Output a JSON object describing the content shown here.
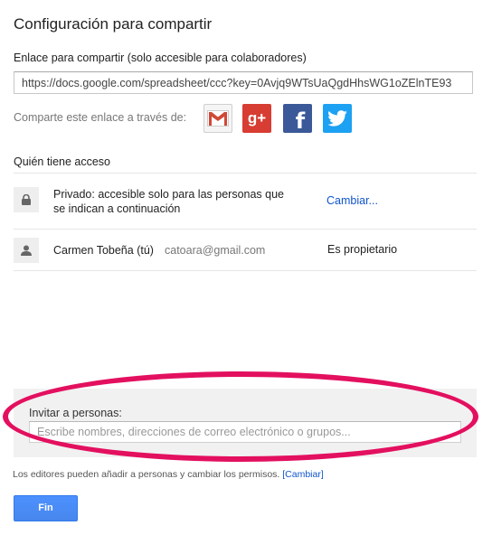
{
  "dialog": {
    "title": "Configuración para compartir",
    "link_label": "Enlace para compartir (solo accesible para colaboradores)",
    "url_value": "https://docs.google.com/spreadsheet/ccc?key=0Avjq9WTsUaQgdHhsWG1oZElnTE93",
    "share_label": "Comparte este enlace a través de:",
    "social": {
      "gmail_icon": "gmail-icon",
      "gplus_label": "g+",
      "facebook_label": "f",
      "twitter_icon": "twitter-icon",
      "colors": {
        "gplus": "#d73d32",
        "facebook": "#3b5998",
        "twitter": "#1da1f2",
        "gmail_red": "#d14836"
      }
    },
    "access": {
      "heading": "Quién tiene acceso",
      "privacy": {
        "icon": "lock-icon",
        "text": "Privado: accesible solo para las personas que se indican a continuación",
        "change_link": "Cambiar..."
      },
      "users": [
        {
          "icon": "person-icon",
          "name": "Carmen Tobeña (tú)",
          "email": "catoara@gmail.com",
          "role": "Es propietario"
        }
      ]
    },
    "invite": {
      "label": "Invitar a personas:",
      "placeholder": "Escribe nombres, direcciones de correo electrónico o grupos...",
      "highlight_color": "#e3105f"
    },
    "footer": {
      "editors_note": "Los editores pueden añadir a personas y cambiar los permisos.",
      "editors_change_link": "[Cambiar]",
      "done_button": "Fin",
      "button_color": "#4d90fe"
    }
  }
}
